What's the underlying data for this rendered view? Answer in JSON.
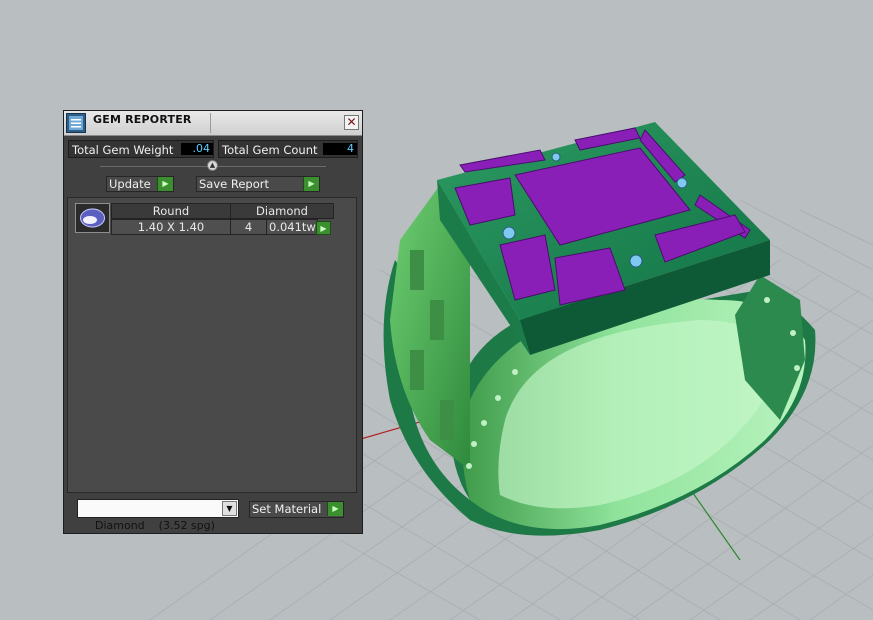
{
  "panel": {
    "title": "GEM REPORTER",
    "close_glyph": "✕",
    "total_gem_weight_label": "Total Gem Weight",
    "total_gem_weight_value": ".04",
    "total_gem_count_label": "Total Gem Count",
    "total_gem_count_value": "4",
    "update_label": "Update",
    "save_report_label": "Save Report",
    "report": {
      "columns": [
        "Round",
        "Diamond"
      ],
      "rows": [
        {
          "size": "1.40 X 1.40",
          "count": "4",
          "weight": "0.041tw"
        }
      ]
    },
    "material": {
      "selected": "Diamond    (3.52 spg)"
    },
    "set_material_label": "Set Material"
  },
  "icons": {
    "title_icon": "gem-reporter-icon",
    "close": "close-icon",
    "arrow": "play-arrow-icon",
    "dropdown": "chevron-down-icon",
    "gem": "gem-thumbnail-icon"
  },
  "colors": {
    "panel_bg": "#404040",
    "value_text": "#5fd0ff",
    "arrow_green": "#3b8f2e",
    "ring_green": "#2e8a52",
    "gem_purple": "#8a1fb8",
    "viewport_bg": "#b9bec1"
  }
}
